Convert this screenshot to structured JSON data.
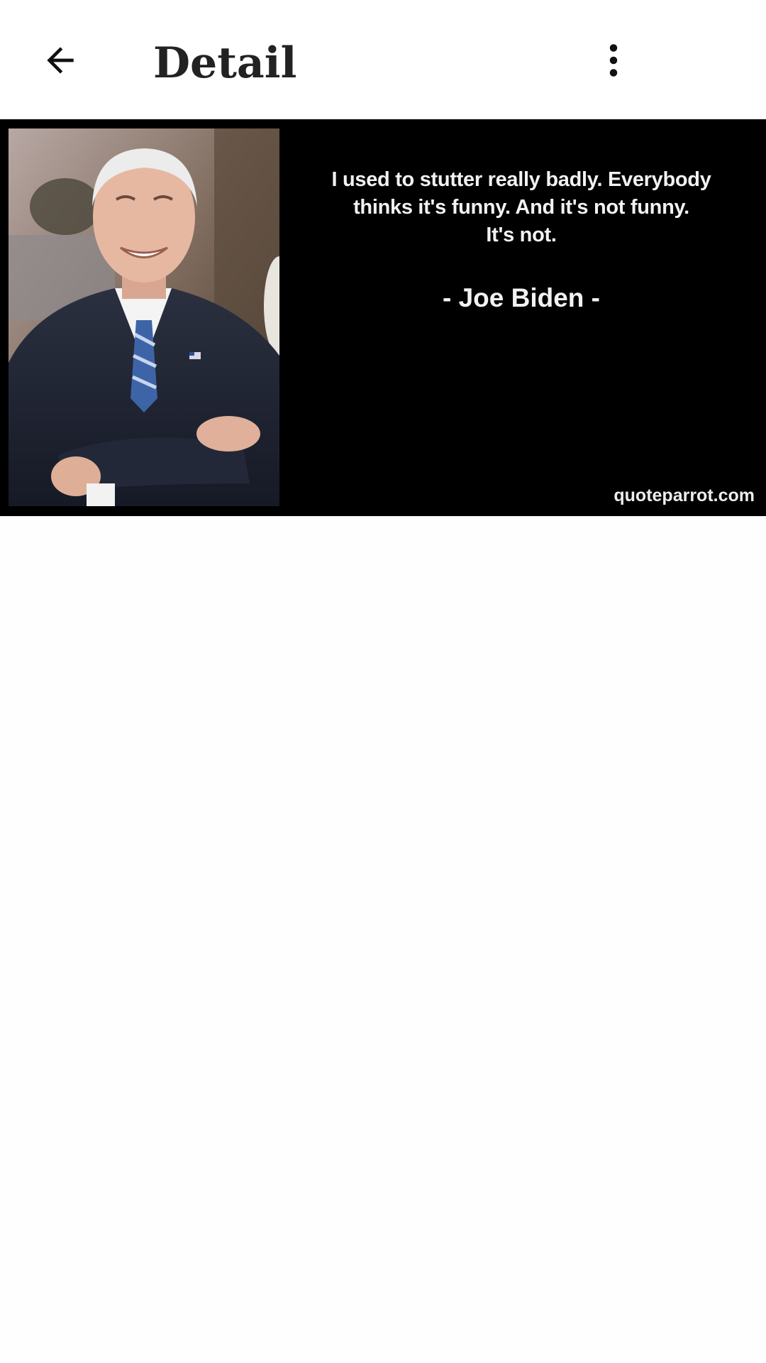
{
  "app_bar": {
    "title": "Detail",
    "back_icon": "arrow-back-icon",
    "more_icon": "more-vert-icon"
  },
  "quote_image": {
    "quote_lines": [
      "I used to stutter really badly. Everybody",
      "thinks it's funny. And it's not funny.",
      "It's not."
    ],
    "author": "- Joe Biden -",
    "watermark": "quoteparrot.com",
    "colors": {
      "background": "#000000",
      "text": "#f2f2f2"
    }
  }
}
